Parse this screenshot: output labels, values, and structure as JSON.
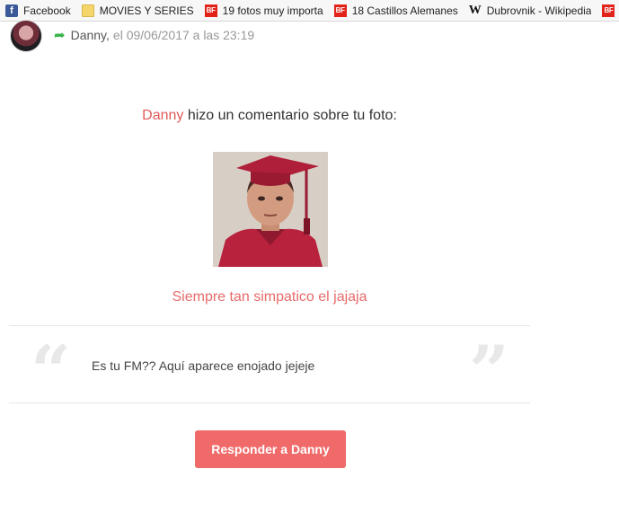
{
  "bookmarks": [
    {
      "label": "Facebook",
      "icon": "facebook-icon"
    },
    {
      "label": "MOVIES Y SERIES",
      "icon": "folder-icon"
    },
    {
      "label": "19 fotos muy importa",
      "icon": "bf-icon"
    },
    {
      "label": "18 Castillos Alemanes",
      "icon": "bf-icon"
    },
    {
      "label": "Dubrovnik - Wikipedia",
      "icon": "wikipedia-icon"
    },
    {
      "label": "",
      "icon": "bf-icon"
    }
  ],
  "header": {
    "author": "Danny,",
    "date": "el 09/06/2017 a las 23:19"
  },
  "main": {
    "name": "Danny",
    "headline_rest": " hizo un comentario sobre tu foto:",
    "comment": "Siempre tan simpatico el jajaja",
    "quote_open": "“",
    "quote_close": "”",
    "quote_text": "Es tu FM?? Aquí aparece enojado jejeje",
    "reply_button": "Responder a Danny"
  },
  "colors": {
    "accent": "#f06a6a",
    "name_red": "#e05a5a",
    "reply_arrow": "#3bb54a"
  }
}
